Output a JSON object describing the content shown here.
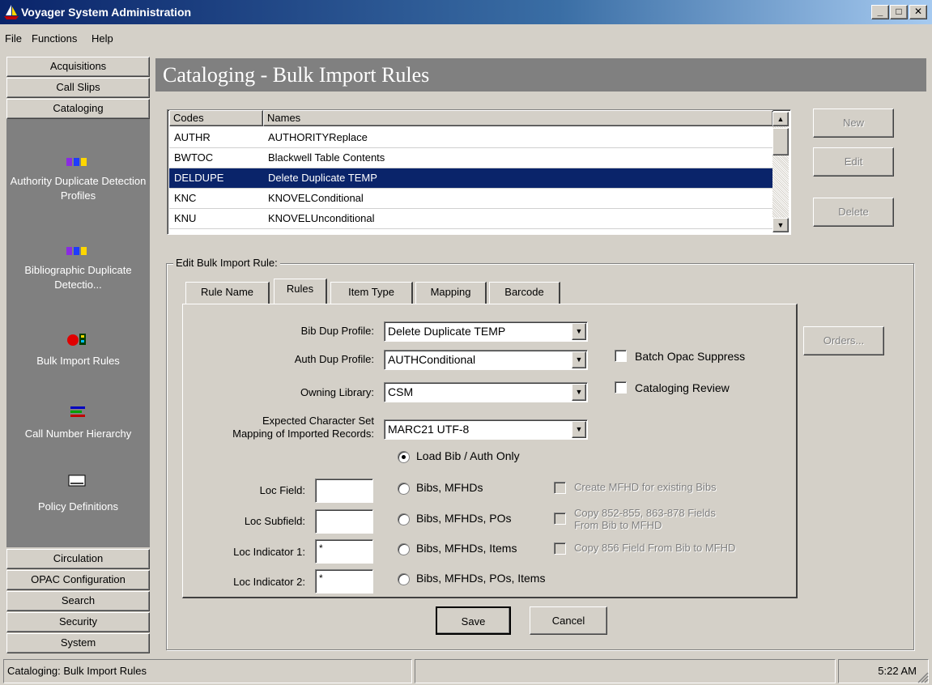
{
  "window": {
    "title": "Voyager System Administration",
    "min": "_",
    "max": "□",
    "close": "✕"
  },
  "menu": [
    {
      "label": "File"
    },
    {
      "label": "Functions"
    },
    {
      "label": "Help"
    }
  ],
  "nav": {
    "top_buttons": [
      "Acquisitions",
      "Call Slips",
      "Cataloging"
    ],
    "items": [
      {
        "label": "Authority Duplicate Detection Profiles",
        "icon": "duplicate-profile-icon"
      },
      {
        "label": "Bibliographic Duplicate Detectio...",
        "icon": "duplicate-profile-icon"
      },
      {
        "label": "Bulk Import Rules",
        "icon": "bulk-import-icon"
      },
      {
        "label": "Call Number Hierarchy",
        "icon": "hierarchy-icon"
      },
      {
        "label": "Policy Definitions",
        "icon": "policy-card-icon"
      }
    ],
    "bottom_buttons": [
      "Circulation",
      "OPAC Configuration",
      "Search",
      "Security",
      "System"
    ]
  },
  "header": {
    "title": "Cataloging - Bulk Import Rules"
  },
  "list": {
    "columns": [
      "Codes",
      "Names"
    ],
    "rows": [
      {
        "code": "AUTHR",
        "name": "AUTHORITYReplace"
      },
      {
        "code": "BWTOC",
        "name": "Blackwell Table Contents"
      },
      {
        "code": "DELDUPE",
        "name": "Delete Duplicate TEMP",
        "selected": true
      },
      {
        "code": "KNC",
        "name": "KNOVELConditional"
      },
      {
        "code": "KNU",
        "name": "KNOVELUnconditional"
      }
    ]
  },
  "actions": {
    "new": "New",
    "edit": "Edit",
    "delete": "Delete",
    "orders": "Orders..."
  },
  "edit": {
    "group_label": "Edit  Bulk Import Rule:",
    "tabs": [
      "Rule Name",
      "Rules",
      "Item Type",
      "Mapping",
      "Barcode"
    ],
    "active_tab": "Rules",
    "bib_dup_label": "Bib Dup Profile:",
    "bib_dup_value": "Delete Duplicate TEMP",
    "auth_dup_label": "Auth Dup Profile:",
    "auth_dup_value": "AUTHConditional",
    "owning_label": "Owning Library:",
    "owning_value": "CSM",
    "charset_label_1": "Expected Character Set",
    "charset_label_2": "Mapping of Imported Records:",
    "charset_value": "MARC21 UTF-8",
    "batch_opac_label": "Batch Opac Suppress",
    "batch_opac_checked": false,
    "cat_review_label": "Cataloging Review",
    "cat_review_checked": false,
    "load_options": [
      {
        "label": "Load Bib / Auth Only",
        "selected": true
      },
      {
        "label": "Bibs, MFHDs",
        "selected": false
      },
      {
        "label": "Bibs, MFHDs, POs",
        "selected": false
      },
      {
        "label": "Bibs, MFHDs, Items",
        "selected": false
      },
      {
        "label": "Bibs, MFHDs, POs, Items",
        "selected": false
      }
    ],
    "loc_field_label": "Loc Field:",
    "loc_field_value": "",
    "loc_subfield_label": "Loc Subfield:",
    "loc_subfield_value": "",
    "loc_ind1_label": "Loc Indicator 1:",
    "loc_ind1_value": "*",
    "loc_ind2_label": "Loc Indicator 2:",
    "loc_ind2_value": "*",
    "create_mfhd_label": "Create MFHD for existing Bibs",
    "copy_852_label_1": "Copy 852-855, 863-878 Fields",
    "copy_852_label_2": "From Bib to MFHD",
    "copy_856_label": "Copy 856 Field From Bib to MFHD",
    "save": "Save",
    "cancel": "Cancel"
  },
  "status": {
    "left": "Cataloging:  Bulk Import Rules",
    "middle": "",
    "time": "5:22 AM"
  }
}
